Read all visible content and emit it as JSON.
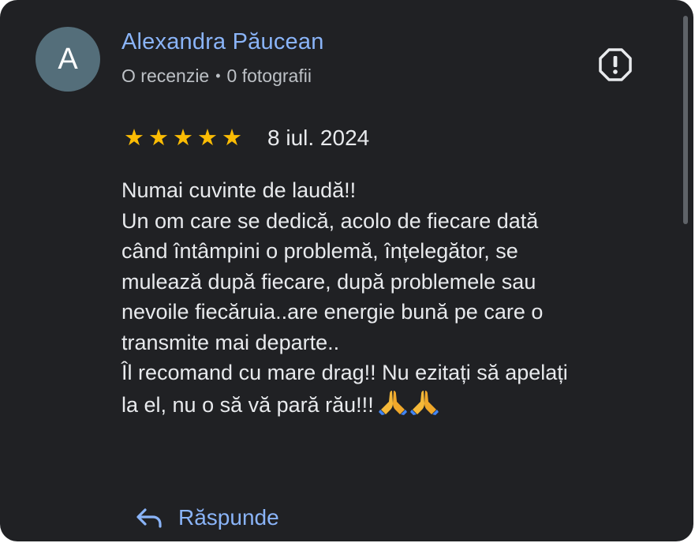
{
  "review": {
    "author_initial": "A",
    "author_name": "Alexandra Păucean",
    "author_reviews": "O recenzie",
    "meta_separator": "•",
    "author_photos": "0 fotografii",
    "rating": 5,
    "rating_max": 5,
    "date": "8 iul. 2024",
    "text_lines": [
      "Numai cuvinte de laudă!!",
      "Un om care se dedică, acolo de fiecare dată",
      "când întâmpini o problemă, înțelegător, se",
      "mulează după fiecare, după problemele sau",
      "nevoile fiecăruia..are energie bună pe care o",
      "transmite mai departe..",
      "Îl recomand cu mare drag!! Nu ezitați să apelați",
      "la el, nu o să vă pară rău!!!"
    ],
    "emoji": [
      "folded-hands-emoji",
      "folded-hands-emoji"
    ]
  },
  "actions": {
    "reply_label": "Răspunde",
    "reply_icon": "reply-arrow-icon",
    "report_icon": "report-octagon-icon"
  },
  "colors": {
    "background": "#202124",
    "name_link": "#8ab4f8",
    "star": "#fbbc04",
    "text": "#e8eaed",
    "secondary_text": "#bdc1c6",
    "avatar": "#546e7a"
  }
}
